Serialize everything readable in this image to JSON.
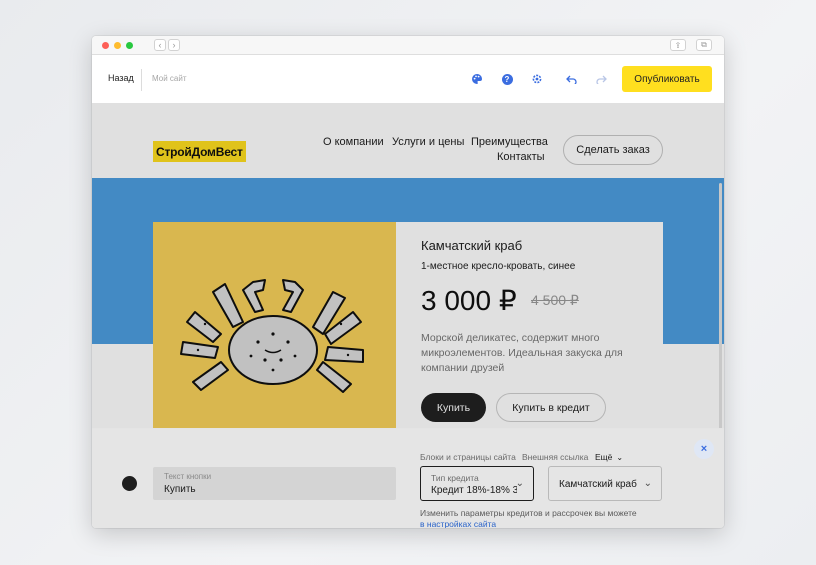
{
  "browser": {
    "back_glyph": "‹",
    "forward_glyph": "›",
    "share_glyph": "⇪",
    "tabs_glyph": "⧉"
  },
  "toolbar": {
    "back_label": "Назад",
    "site_name": "Мой сайт",
    "icons": [
      "palette-icon",
      "help-icon",
      "settings-icon",
      "undo-icon",
      "redo-icon"
    ],
    "publish_label": "Опубликовать",
    "publish_color": "#ffdf1f",
    "accent_color": "#3b6de0"
  },
  "site": {
    "logo": "СтройДомВест",
    "menu": [
      "О компании",
      "Услуги и цены",
      "Преимущества",
      "Контакты"
    ],
    "order_button": "Сделать заказ",
    "band_color": "#4d9ee0",
    "product": {
      "title": "Камчатский краб",
      "subtitle": "1-местное кресло-кровать, синее",
      "price": "3 000 ₽",
      "old_price": "4 500 ₽",
      "description": "Морской деликатес, содержит много микроэлементов. Идеальная закуска для компании друзей",
      "buy_label": "Купить",
      "credit_label": "Купить в кредит",
      "image_bg": "#f7d15a"
    }
  },
  "panel": {
    "button_text_label": "Текст кнопки",
    "button_text_value": "Купить",
    "link_tabs": [
      "Блоки и страницы сайта",
      "Внешняя ссылка",
      "Ещё"
    ],
    "credit_type_label": "Тип кредита",
    "credit_type_value": "Кредит 18%-18% 3",
    "product_select_value": "Камчатский краб",
    "hint_text": "Изменить параметры кредитов и рассрочек вы можете",
    "hint_link": "в настройках сайта",
    "close_glyph": "×"
  }
}
